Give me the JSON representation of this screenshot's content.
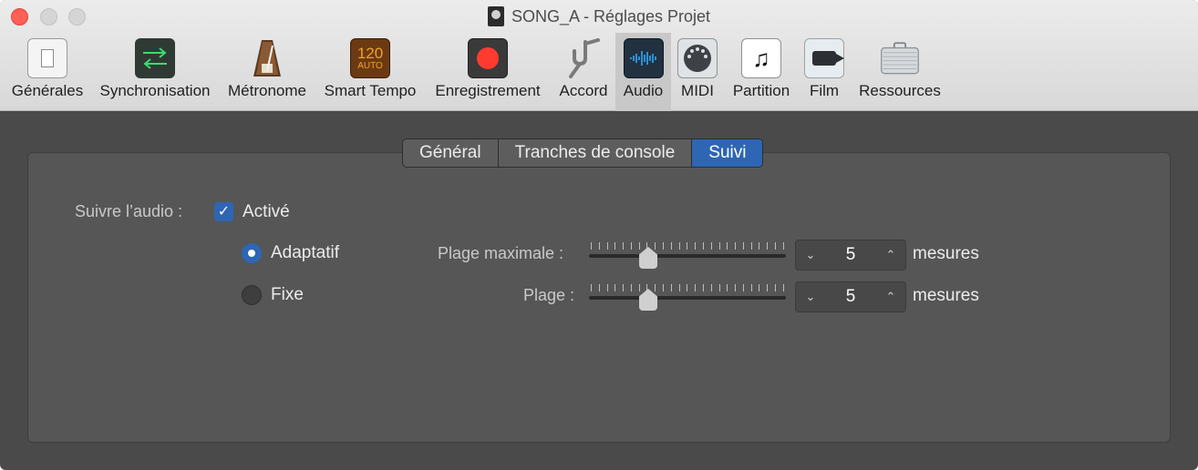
{
  "window": {
    "title": "SONG_A - Réglages Projet"
  },
  "toolbar": {
    "items": [
      {
        "label": "Générales"
      },
      {
        "label": "Synchronisation"
      },
      {
        "label": "Métronome"
      },
      {
        "label": "Smart Tempo",
        "icon_top": "120",
        "icon_bottom": "AUTO"
      },
      {
        "label": "Enregistrement"
      },
      {
        "label": "Accord"
      },
      {
        "label": "Audio",
        "selected": true
      },
      {
        "label": "MIDI"
      },
      {
        "label": "Partition"
      },
      {
        "label": "Film"
      },
      {
        "label": "Ressources"
      }
    ]
  },
  "tabs": [
    {
      "label": "Général"
    },
    {
      "label": "Tranches de console"
    },
    {
      "label": "Suivi",
      "active": true
    }
  ],
  "follow": {
    "label": "Suivre l’audio :",
    "checkbox_label": "Activé",
    "checked": true,
    "modes": [
      {
        "label": "Adaptatif",
        "selected": true
      },
      {
        "label": "Fixe",
        "selected": false
      }
    ]
  },
  "ranges": [
    {
      "label": "Plage maximale :",
      "value": "5",
      "unit": "mesures",
      "slider_level": 0.28
    },
    {
      "label": "Plage :",
      "value": "5",
      "unit": "mesures",
      "slider_level": 0.28
    }
  ],
  "colors": {
    "accent": "#2e66b4",
    "close": "#fe5f57"
  }
}
